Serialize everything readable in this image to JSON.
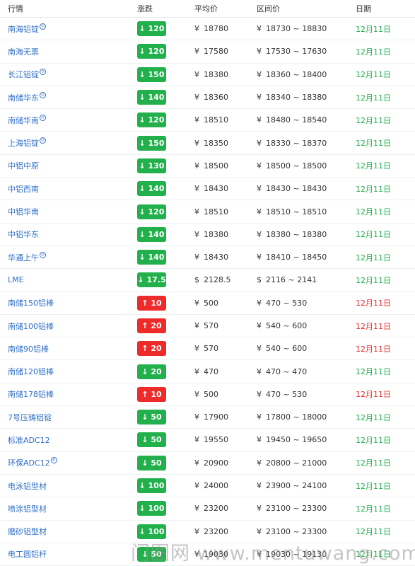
{
  "columns": [
    "行情",
    "涨跌",
    "平均价",
    "区间价",
    "日期"
  ],
  "watermark": "门图网 www.mentuwang.com",
  "colors": {
    "down": "#21b04c",
    "up": "#ee2b2b",
    "link": "#2f6fc7"
  },
  "rows": [
    {
      "name": "南海铝锭",
      "sup": true,
      "dir": "down",
      "change": "↓ 120",
      "cur": "¥",
      "avg": "18780",
      "range": "18730 ~ 18830",
      "date": "12月11日"
    },
    {
      "name": "南海无票",
      "sup": false,
      "dir": "down",
      "change": "↓ 120",
      "cur": "¥",
      "avg": "17580",
      "range": "17530 ~ 17630",
      "date": "12月11日"
    },
    {
      "name": "长江铝锭",
      "sup": true,
      "dir": "down",
      "change": "↓ 150",
      "cur": "¥",
      "avg": "18380",
      "range": "18360 ~ 18400",
      "date": "12月11日"
    },
    {
      "name": "南储华东",
      "sup": true,
      "dir": "down",
      "change": "↓ 140",
      "cur": "¥",
      "avg": "18360",
      "range": "18340 ~ 18380",
      "date": "12月11日"
    },
    {
      "name": "南储华南",
      "sup": true,
      "dir": "down",
      "change": "↓ 120",
      "cur": "¥",
      "avg": "18510",
      "range": "18480 ~ 18540",
      "date": "12月11日"
    },
    {
      "name": "上海铝锭",
      "sup": true,
      "dir": "down",
      "change": "↓ 150",
      "cur": "¥",
      "avg": "18350",
      "range": "18330 ~ 18370",
      "date": "12月11日"
    },
    {
      "name": "中铝中原",
      "sup": false,
      "dir": "down",
      "change": "↓ 130",
      "cur": "¥",
      "avg": "18500",
      "range": "18500 ~ 18500",
      "date": "12月11日"
    },
    {
      "name": "中铝西南",
      "sup": false,
      "dir": "down",
      "change": "↓ 140",
      "cur": "¥",
      "avg": "18430",
      "range": "18430 ~ 18430",
      "date": "12月11日"
    },
    {
      "name": "中铝华南",
      "sup": false,
      "dir": "down",
      "change": "↓ 120",
      "cur": "¥",
      "avg": "18510",
      "range": "18510 ~ 18510",
      "date": "12月11日"
    },
    {
      "name": "中铝华东",
      "sup": false,
      "dir": "down",
      "change": "↓ 140",
      "cur": "¥",
      "avg": "18380",
      "range": "18380 ~ 18380",
      "date": "12月11日"
    },
    {
      "name": "华通上午",
      "sup": true,
      "dir": "down",
      "change": "↓ 140",
      "cur": "¥",
      "avg": "18430",
      "range": "18410 ~ 18450",
      "date": "12月11日"
    },
    {
      "name": "LME",
      "sup": false,
      "dir": "down",
      "change": "↓ 17.5",
      "cur": "$",
      "avg": "2128.5",
      "range": "2116 ~ 2141",
      "date": "12月11日"
    },
    {
      "name": "南储150铝棒",
      "sup": false,
      "dir": "up",
      "change": "↑ 10",
      "cur": "¥",
      "avg": "500",
      "range": "470 ~ 530",
      "date": "12月11日"
    },
    {
      "name": "南储100铝棒",
      "sup": false,
      "dir": "up",
      "change": "↑ 20",
      "cur": "¥",
      "avg": "570",
      "range": "540 ~ 600",
      "date": "12月11日"
    },
    {
      "name": "南储90铝棒",
      "sup": false,
      "dir": "up",
      "change": "↑ 20",
      "cur": "¥",
      "avg": "570",
      "range": "540 ~ 600",
      "date": "12月11日"
    },
    {
      "name": "南储120铝棒",
      "sup": false,
      "dir": "down",
      "change": "↓ 20",
      "cur": "¥",
      "avg": "470",
      "range": "470 ~ 470",
      "date": "12月11日"
    },
    {
      "name": "南储178铝棒",
      "sup": false,
      "dir": "up",
      "change": "↑ 10",
      "cur": "¥",
      "avg": "500",
      "range": "470 ~ 530",
      "date": "12月11日"
    },
    {
      "name": "7号压铸铝锭",
      "sup": false,
      "dir": "down",
      "change": "↓ 50",
      "cur": "¥",
      "avg": "17900",
      "range": "17800 ~ 18000",
      "date": "12月11日"
    },
    {
      "name": "标准ADC12",
      "sup": false,
      "dir": "down",
      "change": "↓ 50",
      "cur": "¥",
      "avg": "19550",
      "range": "19450 ~ 19650",
      "date": "12月11日"
    },
    {
      "name": "环保ADC12",
      "sup": true,
      "dir": "down",
      "change": "↓ 50",
      "cur": "¥",
      "avg": "20900",
      "range": "20800 ~ 21000",
      "date": "12月11日"
    },
    {
      "name": "电泳铝型材",
      "sup": false,
      "dir": "down",
      "change": "↓ 100",
      "cur": "¥",
      "avg": "24000",
      "range": "23900 ~ 24100",
      "date": "12月11日"
    },
    {
      "name": "喷涂铝型材",
      "sup": false,
      "dir": "down",
      "change": "↓ 100",
      "cur": "¥",
      "avg": "23200",
      "range": "23100 ~ 23300",
      "date": "12月11日"
    },
    {
      "name": "磨砂铝型材",
      "sup": false,
      "dir": "down",
      "change": "↓ 100",
      "cur": "¥",
      "avg": "23200",
      "range": "23100 ~ 23300",
      "date": "12月11日"
    },
    {
      "name": "电工圆铝杆",
      "sup": false,
      "dir": "down",
      "change": "↓ 50",
      "cur": "¥",
      "avg": "19030",
      "range": "19030 ~ 19130",
      "date": "12月11日"
    }
  ]
}
